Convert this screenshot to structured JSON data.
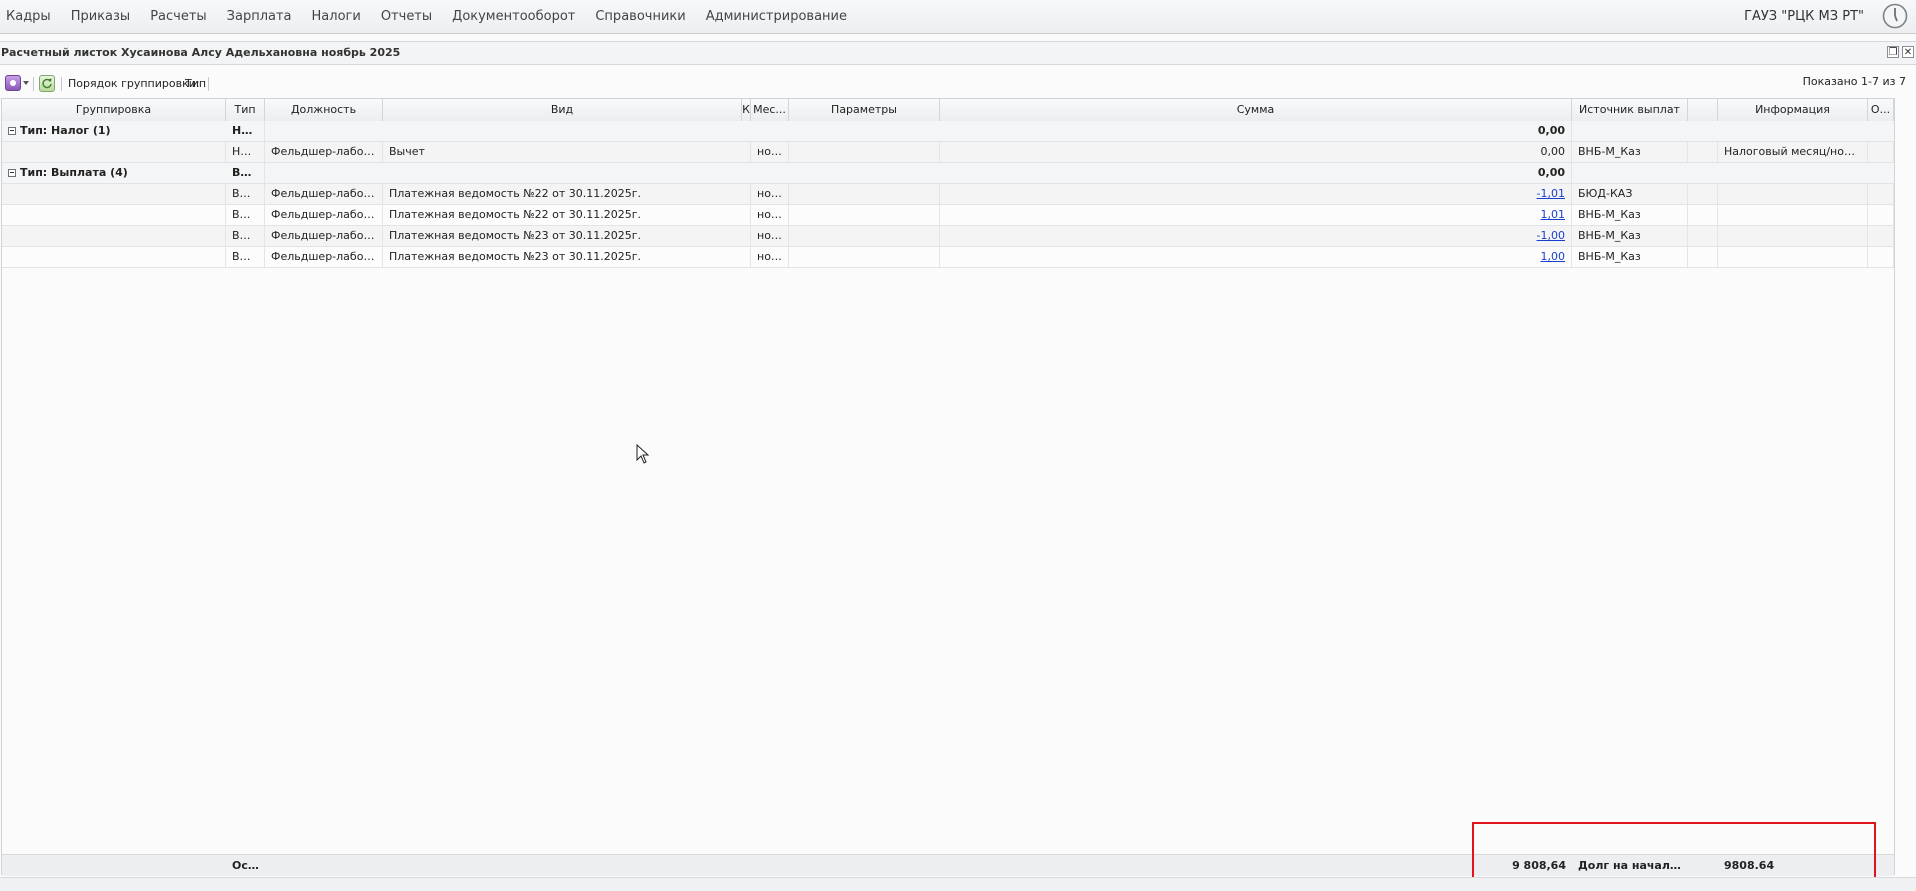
{
  "menu": [
    "Кадры",
    "Приказы",
    "Расчеты",
    "Зарплата",
    "Налоги",
    "Отчеты",
    "Документооборот",
    "Справочники",
    "Администрирование"
  ],
  "org_name": "ГАУЗ \"РЦК МЗ РТ\"",
  "window": {
    "title": "Расчетный листок Хусаинова Алсу Адельхановна ноябрь 2025",
    "restore_icon": "restore-icon",
    "close_icon": "close-icon"
  },
  "toolbar": {
    "group_label": "Порядок группировки:",
    "group_value": "Тип",
    "shown": "Показано 1-7 из 7"
  },
  "columns": [
    "Группировка",
    "Тип",
    "Должность",
    "Вид",
    "К",
    "Мес...",
    "Параметры",
    "Сумма",
    "Источник выплат",
    "",
    "Информация",
    "О..."
  ],
  "groups": [
    {
      "title": "Тип: Налог (1)",
      "type_short": "На...",
      "sum": "0,00",
      "rows": [
        {
          "type": "Нал...",
          "position": "Фельдшер-лаборант",
          "kind": "Вычет",
          "month": "ноя...",
          "sum": "0,00",
          "sum_link": false,
          "source": "ВНБ-М_Каз",
          "info": "Налоговый месяц/ноябрь..."
        }
      ]
    },
    {
      "title": "Тип: Выплата (4)",
      "type_short": "Вы...",
      "sum": "0,00",
      "rows": [
        {
          "type": "Вы...",
          "position": "Фельдшер-лаборант",
          "kind": "Платежная ведомость №22 от 30.11.2025г.",
          "month": "ноя...",
          "sum": "-1,01",
          "sum_link": true,
          "source": "БЮД-КАЗ",
          "info": ""
        },
        {
          "type": "Вы...",
          "position": "Фельдшер-лаборант",
          "kind": "Платежная ведомость №22 от 30.11.2025г.",
          "month": "ноя...",
          "sum": "1,01",
          "sum_link": true,
          "source": "ВНБ-М_Каз",
          "info": ""
        },
        {
          "type": "Вы...",
          "position": "Фельдшер-лаборант",
          "kind": "Платежная ведомость №23 от 30.11.2025г.",
          "month": "ноя...",
          "sum": "-1,00",
          "sum_link": true,
          "source": "ВНБ-М_Каз",
          "info": ""
        },
        {
          "type": "Вы...",
          "position": "Фельдшер-лаборант",
          "kind": "Платежная ведомость №23 от 30.11.2025г.",
          "month": "ноя...",
          "sum": "1,00",
          "sum_link": true,
          "source": "ВНБ-М_Каз",
          "info": ""
        }
      ]
    }
  ],
  "summary": {
    "type": "Ос...",
    "sum": "9 808,64",
    "source": "Долг на начало ...",
    "info": "9808.64"
  },
  "colors": {
    "highlight": "#e0141a",
    "link": "#1a3fd0"
  }
}
